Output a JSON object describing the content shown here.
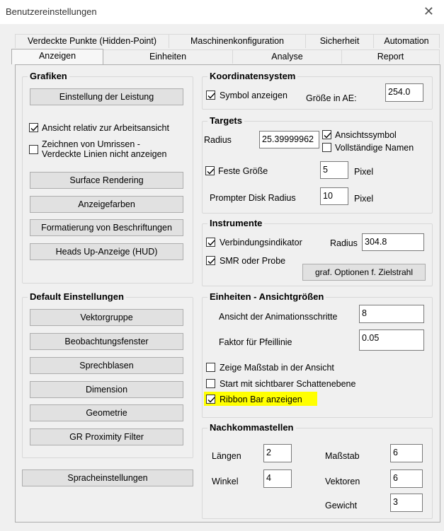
{
  "window": {
    "title": "Benutzereinstellungen",
    "close_glyph": "✕"
  },
  "tabs_row1": [
    "Verdeckte Punkte (Hidden-Point)",
    "Maschinenkonfiguration",
    "Sicherheit",
    "Automation"
  ],
  "tabs_row2": [
    "Anzeigen",
    "Einheiten",
    "Analyse",
    "Report"
  ],
  "grafiken": {
    "title": "Grafiken",
    "btn_leistung": "Einstellung der Leistung",
    "cb_ansicht": {
      "label": "Ansicht relativ zur Arbeitsansicht",
      "checked": true
    },
    "cb_zeichnen": {
      "label_line1": "Zeichnen von Umrissen -",
      "label_line2": "Verdeckte Linien nicht anzeigen",
      "checked": false
    },
    "btn_surface": "Surface Rendering",
    "btn_farben": "Anzeigefarben",
    "btn_format": "Formatierung von Beschriftungen",
    "btn_hud": "Heads Up-Anzeige (HUD)"
  },
  "default": {
    "title": "Default Einstellungen",
    "btn_vektor": "Vektorgruppe",
    "btn_beob": "Beobachtungsfenster",
    "btn_sprech": "Sprechblasen",
    "btn_dim": "Dimension",
    "btn_geo": "Geometrie",
    "btn_gr": "GR Proximity Filter"
  },
  "sprache": "Spracheinstellungen",
  "koord": {
    "title": "Koordinatensystem",
    "cb_symbol": {
      "label": "Symbol anzeigen",
      "checked": true
    },
    "groesse_label": "Größe in AE:",
    "groesse_value": "254.0"
  },
  "targets": {
    "title": "Targets",
    "radius_label": "Radius",
    "radius_value": "25.39999962",
    "cb_ansichtssymbol": {
      "label": "Ansichtssymbol",
      "checked": true
    },
    "cb_namen": {
      "label": "Vollständige Namen",
      "checked": false
    },
    "cb_feste": {
      "label": "Feste Größe",
      "checked": true
    },
    "feste_value": "5",
    "feste_unit": "Pixel",
    "prompter_label": "Prompter Disk Radius",
    "prompter_value": "10",
    "prompter_unit": "Pixel"
  },
  "instrumente": {
    "title": "Instrumente",
    "cb_verbindung": {
      "label": "Verbindungsindikator",
      "checked": true
    },
    "radius_label": "Radius",
    "radius_value": "304.8",
    "cb_smr": {
      "label": "SMR oder Probe",
      "checked": true
    },
    "btn_optionen": "graf. Optionen f. Zielstrahl"
  },
  "einheiten": {
    "title": "Einheiten - Ansichtgrößen",
    "anim_label": "Ansicht der Animationsschritte",
    "anim_value": "8",
    "pfeil_label": "Faktor für Pfeillinie",
    "pfeil_value": "0.05",
    "cb_massstab": {
      "label": "Zeige Maßstab in der Ansicht",
      "checked": false
    },
    "cb_schatten": {
      "label": "Start mit sichtbarer Schattenebene",
      "checked": false
    },
    "cb_ribbon": {
      "label": "Ribbon Bar anzeigen",
      "checked": true
    },
    "highlight_color": "#ffff00"
  },
  "nachkomma": {
    "title": "Nachkommastellen",
    "laengen_label": "Längen",
    "laengen_value": "2",
    "winkel_label": "Winkel",
    "winkel_value": "4",
    "massstab_label": "Maßstab",
    "massstab_value": "6",
    "vektoren_label": "Vektoren",
    "vektoren_value": "6",
    "gewicht_label": "Gewicht",
    "gewicht_value": "3"
  }
}
